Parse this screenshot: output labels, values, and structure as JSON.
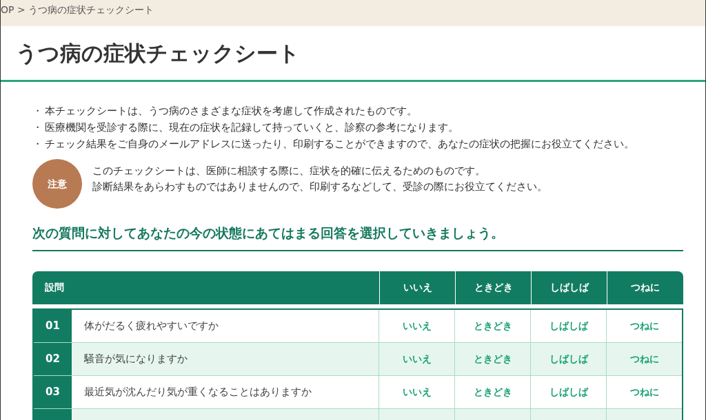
{
  "breadcrumb": "OP > うつ病の症状チェックシート",
  "title": "うつ病の症状チェックシート",
  "bullets": [
    "本チェックシートは、うつ病のさまざまな症状を考慮して作成されたものです。",
    "医療機関を受診する際に、現在の症状を記録して持っていくと、診察の参考になります。",
    "チェック結果をご自身のメールアドレスに送ったり、印刷することができますので、あなたの症状の把握にお役立てください。"
  ],
  "bullet_mark": "・",
  "notice": {
    "badge": "注意",
    "lines": [
      "このチェックシートは、医師に相談する際に、症状を的確に伝えるためのものです。",
      "診断結果をあらわすものではありませんので、印刷するなどして、受診の際にお役立てください。"
    ]
  },
  "section_heading": "次の質問に対してあなたの今の状態にあてはまる回答を選択していきましょう。",
  "table": {
    "columns": [
      "設問",
      "いいえ",
      "ときどき",
      "しばしば",
      "つねに"
    ],
    "rows": [
      {
        "number": "01",
        "question": "体がだるく疲れやすいですか",
        "answers": [
          {
            "label": "いいえ",
            "selected": false
          },
          {
            "label": "ときどき",
            "selected": false
          },
          {
            "label": "しばしば",
            "selected": false
          },
          {
            "label": "つねに",
            "selected": false
          }
        ]
      },
      {
        "number": "02",
        "question": "騒音が気になりますか",
        "answers": [
          {
            "label": "いいえ",
            "selected": false
          },
          {
            "label": "ときどき",
            "selected": false
          },
          {
            "label": "しばしば",
            "selected": false
          },
          {
            "label": "つねに",
            "selected": false
          }
        ]
      },
      {
        "number": "03",
        "question": "最近気が沈んだり気が重くなることはありますか",
        "answers": [
          {
            "label": "いいえ",
            "selected": false
          },
          {
            "label": "ときどき",
            "selected": false
          },
          {
            "label": "しばしば",
            "selected": false
          },
          {
            "label": "つねに",
            "selected": false
          }
        ]
      }
    ]
  }
}
